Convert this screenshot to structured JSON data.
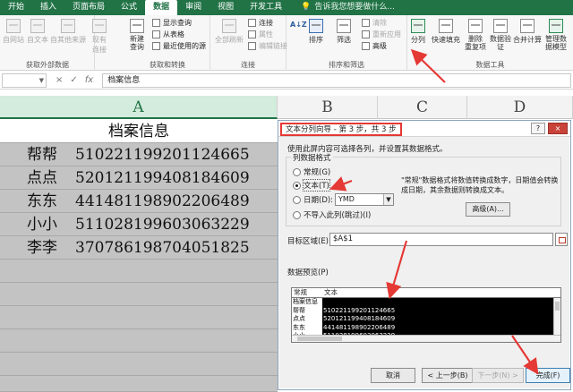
{
  "ribbon": {
    "tabs": [
      "开始",
      "插入",
      "页面布局",
      "公式",
      "数据",
      "审阅",
      "视图",
      "开发工具"
    ],
    "active_tab": "数据",
    "tell_me": "告诉我您想要做什么...",
    "groups": {
      "get_external": {
        "label": "获取外部数据",
        "buttons": [
          "自网站",
          "自文本",
          "自其他来源",
          "现有连接"
        ]
      },
      "get_transform": {
        "label": "获取和转换",
        "new_query": "新建\n查询",
        "items": [
          "显示查询",
          "从表格",
          "最近使用的源"
        ]
      },
      "connections": {
        "label": "连接",
        "refresh": "全部刷新",
        "items": [
          "连接",
          "属性",
          "编辑链接"
        ]
      },
      "sort_filter": {
        "label": "排序和筛选",
        "sort_az": "A↓Z",
        "sort": "排序",
        "filter": "筛选",
        "items": [
          "清除",
          "重新应用",
          "高级"
        ]
      },
      "data_tools": {
        "label": "数据工具",
        "buttons": [
          "分列",
          "快速填充",
          "删除\n重复项",
          "数据验\n证",
          "合并计算",
          "管理数\n据模型"
        ]
      }
    }
  },
  "formula_bar": {
    "name_box": "",
    "cancel": "×",
    "enter": "✓",
    "fx": "fx",
    "content": "档案信息"
  },
  "sheet": {
    "columns": [
      "A",
      "B",
      "C",
      "D"
    ],
    "header": "档案信息",
    "rows": [
      {
        "name": "帮帮",
        "id": "510221199201124665"
      },
      {
        "name": "点点",
        "id": "520121199408184609"
      },
      {
        "name": "东东",
        "id": "441481198902206489"
      },
      {
        "name": "小小",
        "id": "511028199603063229"
      },
      {
        "name": "李李",
        "id": "370786198704051825"
      }
    ]
  },
  "dialog": {
    "title": "文本分列向导 - 第 3 步，共 3 步",
    "help": "?",
    "close": "×",
    "instruction": "使用此屏内容可选择各列，并设置其数据格式。",
    "format_legend": "列数据格式",
    "options": [
      "常规(G)",
      "文本(T)",
      "日期(D):",
      "不导入此列(跳过)(I)"
    ],
    "selected_option": "文本(T)",
    "date_format": "YMD",
    "note": "\"常规\"数据格式将数值转换成数字，日期值会转换成日期，其余数据则转换成文本。",
    "advanced": "高级(A)...",
    "target_label": "目标区域(E):",
    "target_value": "$A$1",
    "preview_label": "数据预览(P)",
    "preview_header": [
      "常规",
      "文本"
    ],
    "preview_rows": [
      [
        "档案信息",
        ""
      ],
      [
        "帮帮",
        "510221199201124665"
      ],
      [
        "点点",
        "520121199408184609"
      ],
      [
        "东东",
        "441481198902206489"
      ],
      [
        "小小",
        "511028199603063229"
      ]
    ],
    "buttons": {
      "cancel": "取消",
      "back": "< 上一步(B)",
      "next": "下一步(N) >",
      "finish": "完成(F)"
    }
  },
  "colors": {
    "excel_green": "#217346",
    "annotation_red": "#e53935",
    "selected_row": "#c3c3c3"
  }
}
